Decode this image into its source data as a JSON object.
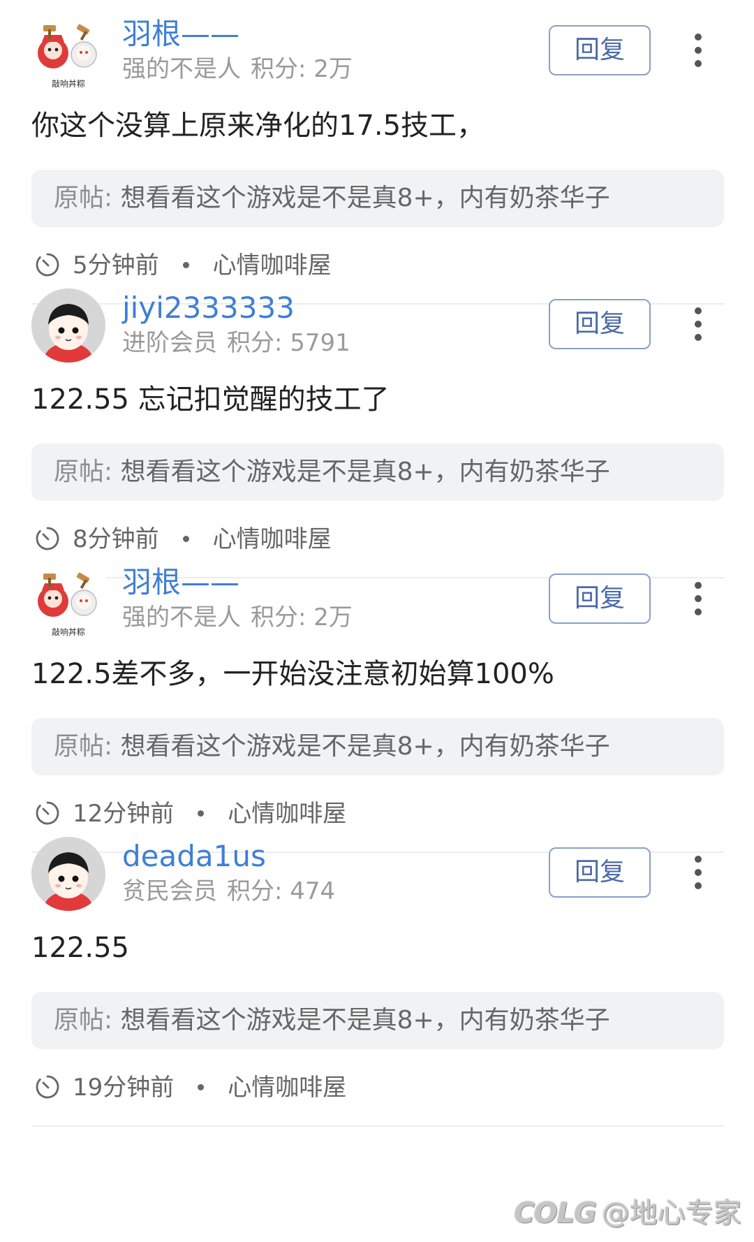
{
  "posts": [
    {
      "username": "羽根——",
      "rank": "强的不是人",
      "score": "积分: 2万",
      "avatar_type": "avatar-stamp-image",
      "avatar_caption": "敲响丼粽",
      "content": "你这个没算上原来净化的17.5技工，",
      "quote_label": "原帖:",
      "quote_text": "想看看这个游戏是不是真8+，内有奶茶华子",
      "time": "5分钟前",
      "board": "心情咖啡屋",
      "reply_label": "回复"
    },
    {
      "username": "jiyi2333333",
      "rank": "进阶会员",
      "score": "积分: 5791",
      "avatar_type": "avatar-default-face",
      "content": "122.55 忘记扣觉醒的技工了",
      "quote_label": "原帖:",
      "quote_text": "想看看这个游戏是不是真8+，内有奶茶华子",
      "time": "8分钟前",
      "board": "心情咖啡屋",
      "reply_label": "回复"
    },
    {
      "username": "羽根——",
      "rank": "强的不是人",
      "score": "积分: 2万",
      "avatar_type": "avatar-stamp-image",
      "avatar_caption": "敲响丼粽",
      "content": "122.5差不多，一开始没注意初始算100%",
      "quote_label": "原帖:",
      "quote_text": "想看看这个游戏是不是真8+，内有奶茶华子",
      "time": "12分钟前",
      "board": "心情咖啡屋",
      "reply_label": "回复"
    },
    {
      "username": "deada1us",
      "rank": "贫民会员",
      "score": "积分: 474",
      "avatar_type": "avatar-default-face",
      "content": "122.55",
      "quote_label": "原帖:",
      "quote_text": "想看看这个游戏是不是真8+，内有奶茶华子",
      "time": "19分钟前",
      "board": "心情咖啡屋",
      "reply_label": "回复"
    }
  ],
  "watermark": {
    "logo": "COLG",
    "handle": "@地心专家"
  },
  "colors": {
    "username": "#3f7fd4",
    "reply_border": "#8aa0c4",
    "quote_bg": "#f1f2f4"
  }
}
